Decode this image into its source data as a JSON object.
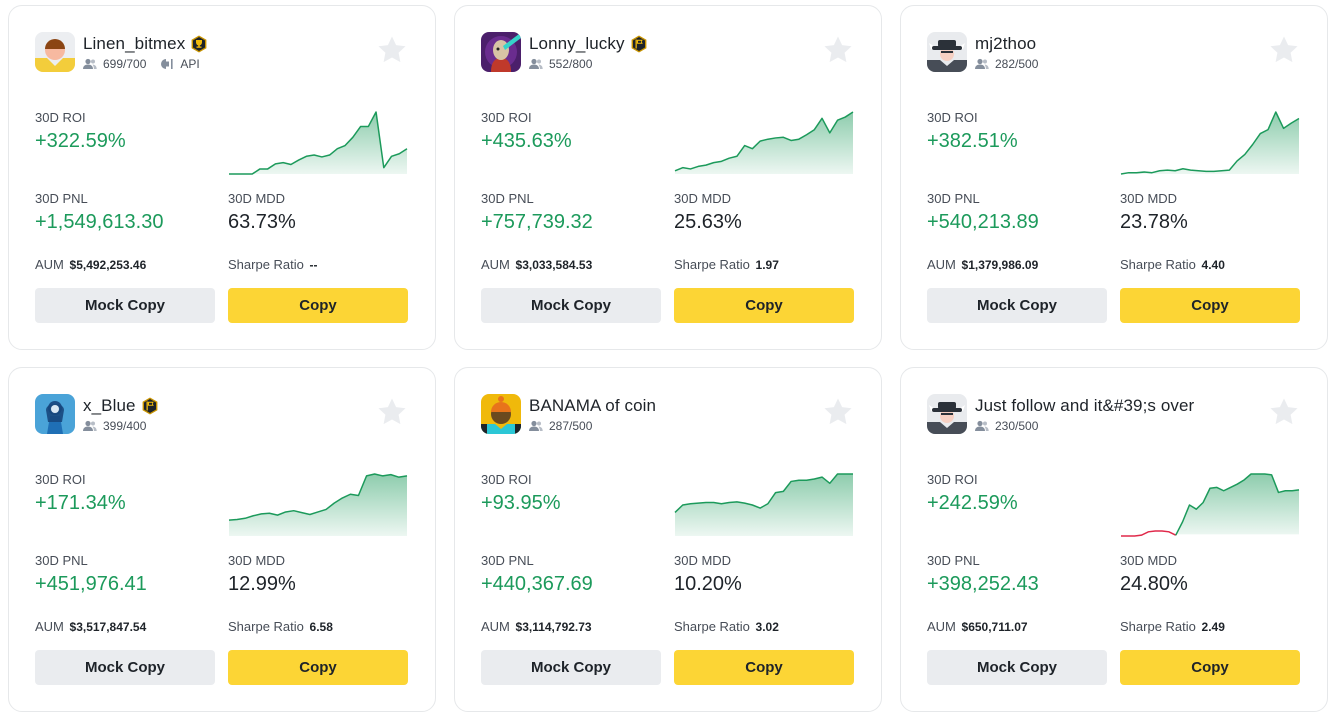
{
  "colors": {
    "positive": "#1c9a5b",
    "negative": "#e0294a",
    "primary_button": "#fcd535",
    "secondary_button": "#eaecef",
    "text": "#1e2329",
    "muted": "#474d57"
  },
  "labels": {
    "roi": "30D ROI",
    "pnl": "30D PNL",
    "mdd": "30D MDD",
    "aum": "AUM",
    "sharpe": "Sharpe Ratio",
    "mock_copy": "Mock Copy",
    "copy": "Copy"
  },
  "cards": [
    {
      "name": "Linen_bitmex",
      "avatar": "avatar-yellow-brown-hair",
      "badge": "trophy-badge-icon",
      "followers": "699/700",
      "api_label": "API",
      "roi": "+322.59%",
      "pnl": "+1,549,613.30",
      "mdd": "63.73%",
      "aum": "$5,492,253.46",
      "sharpe": "--",
      "favorited": false,
      "sparkline": {
        "values": [
          0,
          0,
          0,
          0,
          0.08,
          0.08,
          0.16,
          0.18,
          0.15,
          0.22,
          0.28,
          0.3,
          0.27,
          0.3,
          0.4,
          0.45,
          0.58,
          0.75,
          0.75,
          0.98,
          0.1,
          0.28,
          0.32,
          0.4
        ],
        "negative_until": 0
      }
    },
    {
      "name": "Lonny_lucky",
      "avatar": "avatar-nft-ape",
      "badge": "flag-badge-icon",
      "followers": "552/800",
      "roi": "+435.63%",
      "pnl": "+757,739.32",
      "mdd": "25.63%",
      "aum": "$3,033,584.53",
      "sharpe": "1.97",
      "favorited": false,
      "sparkline": {
        "values": [
          0.05,
          0.1,
          0.08,
          0.12,
          0.14,
          0.18,
          0.2,
          0.25,
          0.28,
          0.45,
          0.4,
          0.52,
          0.55,
          0.57,
          0.58,
          0.53,
          0.55,
          0.62,
          0.7,
          0.88,
          0.65,
          0.85,
          0.9,
          0.98
        ],
        "negative_until": 0
      }
    },
    {
      "name": "mj2thoo",
      "avatar": "avatar-bull-hat",
      "followers": "282/500",
      "roi": "+382.51%",
      "pnl": "+540,213.89",
      "mdd": "23.78%",
      "aum": "$1,379,986.09",
      "sharpe": "4.40",
      "favorited": false,
      "sparkline": {
        "values": [
          0,
          0.02,
          0.02,
          0.03,
          0.02,
          0.05,
          0.06,
          0.05,
          0.08,
          0.06,
          0.05,
          0.04,
          0.04,
          0.05,
          0.06,
          0.2,
          0.3,
          0.45,
          0.62,
          0.68,
          0.95,
          0.7,
          0.78,
          0.85
        ],
        "negative_until": 0
      }
    },
    {
      "name": "x_Blue",
      "avatar": "avatar-blue-girl",
      "badge": "flag-badge-icon",
      "followers": "399/400",
      "roi": "+171.34%",
      "pnl": "+451,976.41",
      "mdd": "12.99%",
      "aum": "$3,517,847.54",
      "sharpe": "6.58",
      "favorited": false,
      "sparkline": {
        "values": [
          0.25,
          0.26,
          0.28,
          0.32,
          0.35,
          0.36,
          0.33,
          0.38,
          0.4,
          0.37,
          0.34,
          0.38,
          0.42,
          0.52,
          0.6,
          0.66,
          0.64,
          0.95,
          0.98,
          0.95,
          0.97,
          0.93,
          0.95
        ],
        "negative_until": 0
      }
    },
    {
      "name": "BANAMA of coin",
      "avatar": "avatar-orange-hat",
      "followers": "287/500",
      "roi": "+93.95%",
      "pnl": "+440,367.69",
      "mdd": "10.20%",
      "aum": "$3,114,792.73",
      "sharpe": "3.02",
      "favorited": false,
      "sparkline": {
        "values": [
          0.38,
          0.5,
          0.52,
          0.53,
          0.54,
          0.54,
          0.52,
          0.54,
          0.55,
          0.53,
          0.5,
          0.45,
          0.52,
          0.7,
          0.72,
          0.88,
          0.9,
          0.9,
          0.92,
          0.95,
          0.85,
          1.0,
          1.0,
          1.0
        ],
        "negative_until": 0
      }
    },
    {
      "name": "Just follow and it&#39;s over",
      "avatar": "avatar-bull-hat",
      "followers": "230/500",
      "roi": "+242.59%",
      "pnl": "+398,252.43",
      "mdd": "24.80%",
      "aum": "$650,711.07",
      "sharpe": "2.49",
      "favorited": false,
      "sparkline": {
        "values": [
          -0.02,
          -0.02,
          -0.02,
          -0.01,
          0.03,
          0.04,
          0.04,
          0.03,
          -0.01,
          0.15,
          0.35,
          0.3,
          0.38,
          0.55,
          0.56,
          0.52,
          0.56,
          0.6,
          0.65,
          0.72,
          0.72,
          0.72,
          0.71,
          0.5,
          0.52,
          0.52,
          0.53
        ],
        "negative_until": 8
      }
    }
  ]
}
